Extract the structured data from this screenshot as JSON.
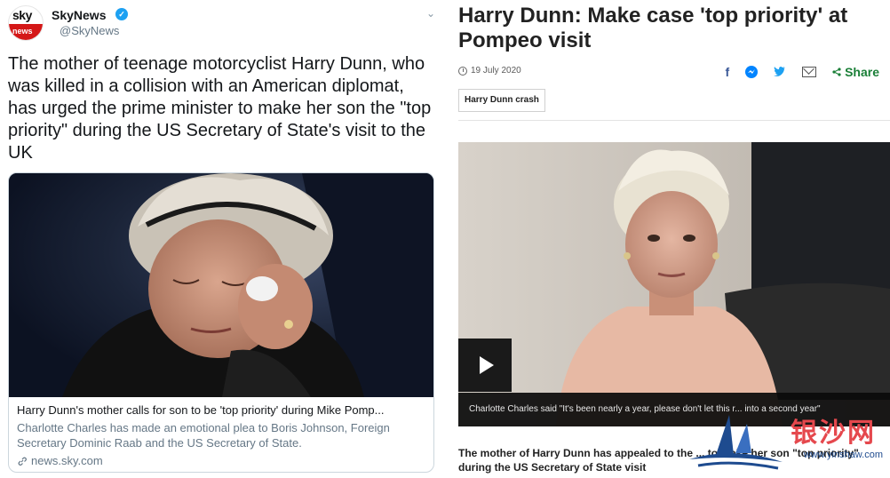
{
  "tweet": {
    "account_name": "SkyNews",
    "account_handle": "@SkyNews",
    "avatar_logo_top": "sky",
    "avatar_logo_bottom": "news",
    "text": "The mother of teenage motorcyclist Harry Dunn, who was killed in a collision with an American diplomat, has urged the prime minister to make her son the \"top priority\" during the US Secretary of State's visit to the UK",
    "card": {
      "title": "Harry Dunn's mother calls for son to be 'top priority' during Mike Pomp...",
      "description": "Charlotte Charles has made an emotional plea to Boris Johnson, Foreign Secretary Dominic Raab and the US Secretary of State.",
      "domain": "news.sky.com"
    }
  },
  "article": {
    "headline": "Harry Dunn: Make case 'top priority' at Pompeo visit",
    "date": "19 July 2020",
    "share_label": "Share",
    "tag": "Harry Dunn crash",
    "video_caption": "Charlotte Charles said \"It's been nearly a year, please don't let this r... into a second year\"",
    "lead": "The mother of Harry Dunn has appealed to the ... to make her son \"top priority\" during the US Secretary of State visit"
  },
  "watermark": {
    "text": "银沙网",
    "url": "www.yinshaw.com"
  },
  "colors": {
    "twitter_blue": "#1da1f2",
    "sky_red": "#d41717",
    "facebook": "#3b5998",
    "messenger": "#0084ff",
    "share_green": "#1a7f37",
    "watermark_red": "#e5484d"
  }
}
